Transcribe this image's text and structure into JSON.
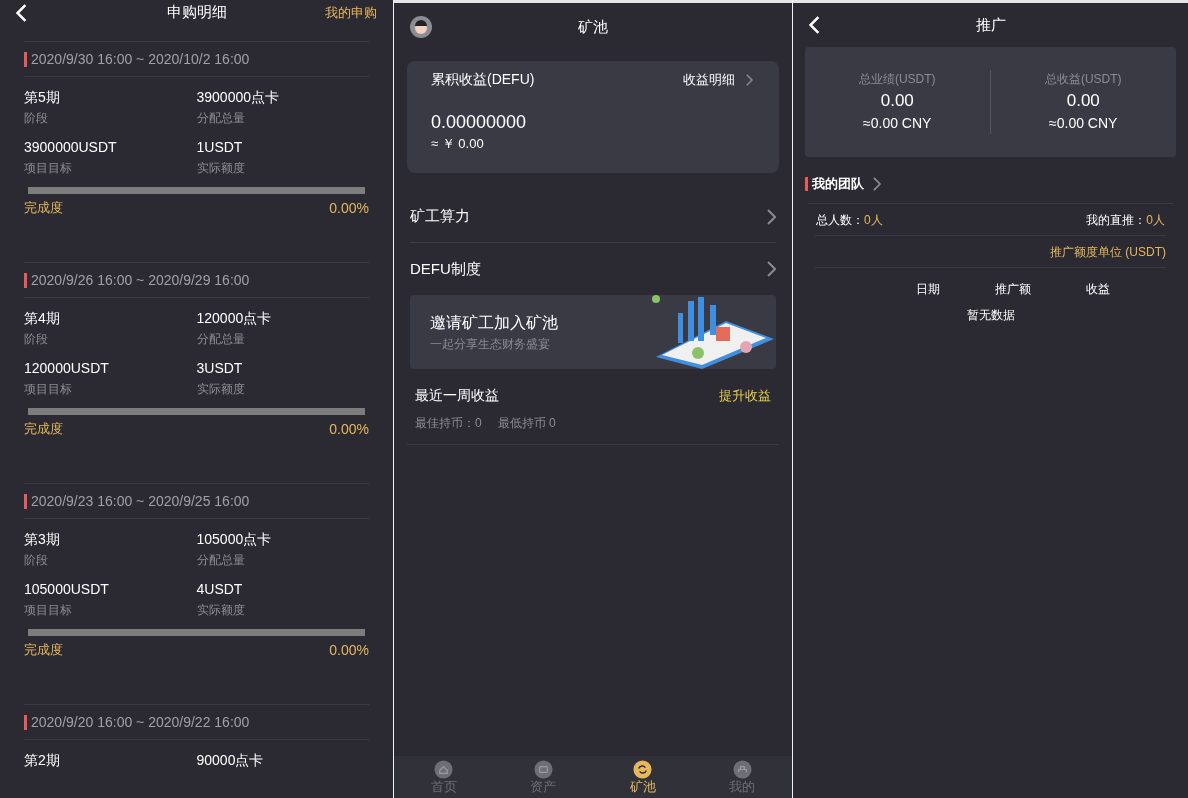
{
  "subscription": {
    "title": "申购明细",
    "action": "我的申购",
    "periods": [
      {
        "date": "2020/9/30 16:00 ~ 2020/10/2 16:00",
        "fields": [
          {
            "value": "第5期",
            "label": "阶段"
          },
          {
            "value": "3900000点卡",
            "label": "分配总量"
          },
          {
            "value": "3900000USDT",
            "label": "项目目标"
          },
          {
            "value": "1USDT",
            "label": "实际额度"
          }
        ],
        "progress_label": "完成度",
        "level": 0,
        "reading": "0.00%"
      },
      {
        "date": "2020/9/26 16:00 ~ 2020/9/29 16:00",
        "fields": [
          {
            "value": "第4期",
            "label": "阶段"
          },
          {
            "value": "120000点卡",
            "label": "分配总量"
          },
          {
            "value": "120000USDT",
            "label": "项目目标"
          },
          {
            "value": "3USDT",
            "label": "实际额度"
          }
        ],
        "progress_label": "完成度",
        "level": 0,
        "reading": "0.00%"
      },
      {
        "date": "2020/9/23 16:00 ~ 2020/9/25 16:00",
        "fields": [
          {
            "value": "第3期",
            "label": "阶段"
          },
          {
            "value": "105000点卡",
            "label": "分配总量"
          },
          {
            "value": "105000USDT",
            "label": "项目目标"
          },
          {
            "value": "4USDT",
            "label": "实际额度"
          }
        ],
        "progress_label": "完成度",
        "level": 0,
        "reading": "0.00%"
      },
      {
        "date": "2020/9/20 16:00 ~ 2020/9/22 16:00",
        "fields": [
          {
            "value": "第2期"
          },
          {
            "value": "90000点卡"
          }
        ]
      }
    ]
  },
  "mining": {
    "title": "矿池",
    "earnings_card": {
      "title": "累积收益(DEFU)",
      "link": "收益明细",
      "amount": "0.00000000",
      "approx": "≈ ￥ 0.00"
    },
    "menu": [
      {
        "label": "矿工算力"
      },
      {
        "label": "DEFU制度"
      }
    ],
    "banner": {
      "title": "邀请矿工加入矿池",
      "subtitle": "一起分享生态财务盛宴"
    },
    "weekly": {
      "title": "最近一周收益",
      "action": "提升收益",
      "best": "最佳持币：0",
      "lowest": "最低持币 0"
    },
    "tabbar": [
      {
        "label": "首页",
        "kind": "home",
        "selected": false
      },
      {
        "label": "资产",
        "kind": "wallet",
        "selected": false
      },
      {
        "label": "矿池",
        "kind": "cycle",
        "selected": true
      },
      {
        "label": "我的",
        "kind": "user",
        "selected": false
      }
    ]
  },
  "promotion": {
    "title": "推广",
    "stats": [
      {
        "label": "总业绩(USDT)",
        "value": "0.00",
        "approx": "≈0.00 CNY"
      },
      {
        "label": "总收益(USDT)",
        "value": "0.00",
        "approx": "≈0.00 CNY"
      }
    ],
    "team_title": "我的团队",
    "total_label": "总人数：",
    "total_value": "0人",
    "direct_label": "我的直推：",
    "direct_value": "0人",
    "unit_note": "推广额度单位 (USDT)",
    "columns": [
      "日期",
      "推广额",
      "收益"
    ],
    "empty": "暂无数据"
  }
}
